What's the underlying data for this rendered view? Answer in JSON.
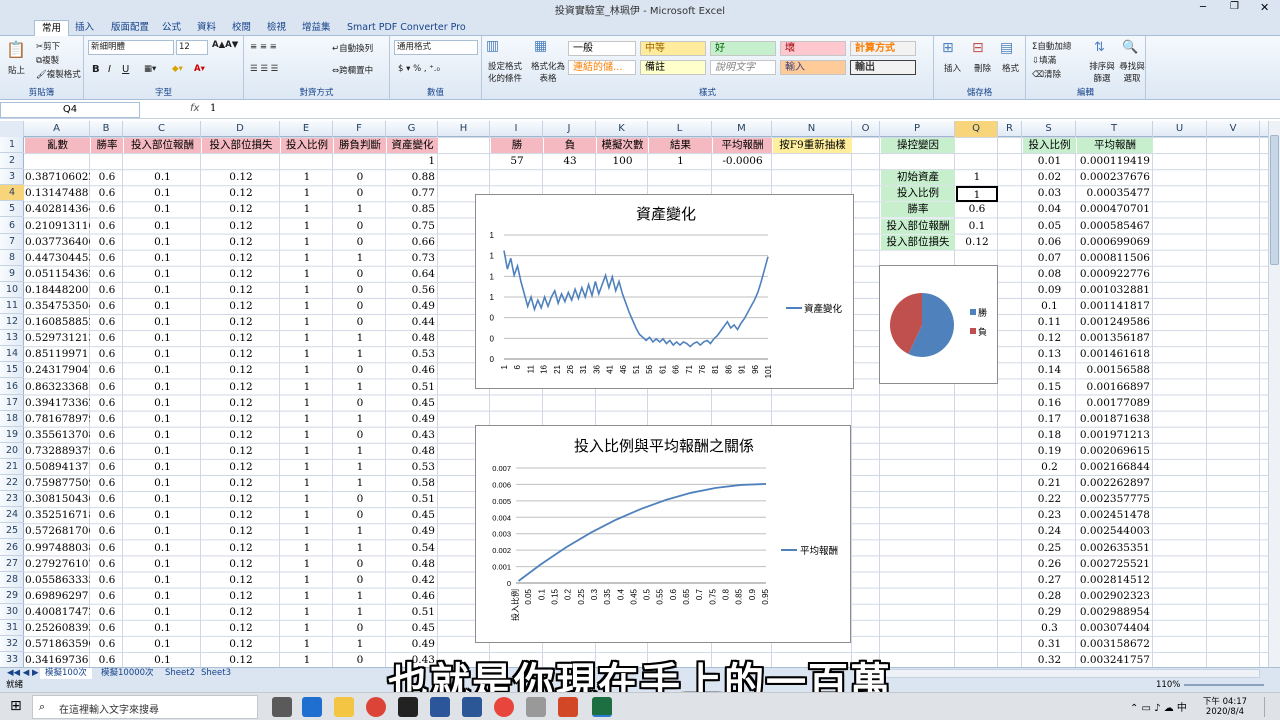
{
  "window": {
    "title": "投資實驗室_林珮伊 - Microsoft Excel"
  },
  "tabs": [
    "常用",
    "插入",
    "版面配置",
    "公式",
    "資料",
    "校閱",
    "檢視",
    "增益集",
    "Smart PDF Converter Pro"
  ],
  "ribbon": {
    "paste": "貼上",
    "cut": "剪下",
    "copy": "複製",
    "format_painter": "複製格式",
    "font_name": "新細明體",
    "font_size": "12",
    "num_format": "通用格式",
    "wrap": "自動換列",
    "merge": "跨欄置中",
    "cond_format": "設定格式化的條件",
    "table_format": "格式化為表格",
    "styles": [
      "一般",
      "中等",
      "好",
      "壞",
      "計算方式",
      "連結的儲...",
      "備註",
      "說明文字",
      "輸入",
      "輸出"
    ],
    "insert": "插入",
    "delete": "刪除",
    "format": "格式",
    "autosum": "自動加總",
    "fill": "填滿",
    "clear": "清除",
    "sort": "排序與篩選",
    "find": "尋找與選取",
    "groups": [
      "剪貼簿",
      "字型",
      "對齊方式",
      "數值",
      "樣式",
      "儲存格",
      "編輯"
    ]
  },
  "formula_bar": {
    "name_box": "Q4",
    "fx": "fx",
    "value": "1"
  },
  "columns": [
    "A",
    "B",
    "C",
    "D",
    "E",
    "F",
    "G",
    "H",
    "I",
    "J",
    "K",
    "L",
    "M",
    "N",
    "O",
    "P",
    "Q",
    "R",
    "S",
    "T",
    "U",
    "V"
  ],
  "rows": [
    "1",
    "2",
    "3",
    "4",
    "5",
    "6",
    "7",
    "8",
    "9",
    "10",
    "11",
    "12",
    "13",
    "14",
    "15",
    "16",
    "17",
    "18",
    "19",
    "20",
    "21",
    "22",
    "23",
    "24",
    "25",
    "26",
    "27",
    "28",
    "29",
    "30",
    "31",
    "32",
    "33"
  ],
  "headers_left": [
    "亂數",
    "勝率",
    "投入部位報酬",
    "投入部位損失",
    "投入比例",
    "勝負判斷",
    "資產變化"
  ],
  "g2": "1",
  "left_data": [
    [
      "0.387106022",
      "0.6",
      "0.1",
      "0.12",
      "1",
      "0",
      "0.88"
    ],
    [
      "0.131474881",
      "0.6",
      "0.1",
      "0.12",
      "1",
      "0",
      "0.77"
    ],
    [
      "0.402814364",
      "0.6",
      "0.1",
      "0.12",
      "1",
      "1",
      "0.85"
    ],
    [
      "0.210913116",
      "0.6",
      "0.1",
      "0.12",
      "1",
      "0",
      "0.75"
    ],
    [
      "0.037736406",
      "0.6",
      "0.1",
      "0.12",
      "1",
      "0",
      "0.66"
    ],
    [
      "0.447304453",
      "0.6",
      "0.1",
      "0.12",
      "1",
      "1",
      "0.73"
    ],
    [
      "0.051154362",
      "0.6",
      "0.1",
      "0.12",
      "1",
      "0",
      "0.64"
    ],
    [
      "0.184482001",
      "0.6",
      "0.1",
      "0.12",
      "1",
      "0",
      "0.56"
    ],
    [
      "0.354753504",
      "0.6",
      "0.1",
      "0.12",
      "1",
      "0",
      "0.49"
    ],
    [
      "0.160858852",
      "0.6",
      "0.1",
      "0.12",
      "1",
      "0",
      "0.44"
    ],
    [
      "0.529731213",
      "0.6",
      "0.1",
      "0.12",
      "1",
      "1",
      "0.48"
    ],
    [
      "0.85119971",
      "0.6",
      "0.1",
      "0.12",
      "1",
      "1",
      "0.53"
    ],
    [
      "0.243179047",
      "0.6",
      "0.1",
      "0.12",
      "1",
      "0",
      "0.46"
    ],
    [
      "0.86323368",
      "0.6",
      "0.1",
      "0.12",
      "1",
      "1",
      "0.51"
    ],
    [
      "0.394173362",
      "0.6",
      "0.1",
      "0.12",
      "1",
      "0",
      "0.45"
    ],
    [
      "0.781678979",
      "0.6",
      "0.1",
      "0.12",
      "1",
      "1",
      "0.49"
    ],
    [
      "0.355613708",
      "0.6",
      "0.1",
      "0.12",
      "1",
      "0",
      "0.43"
    ],
    [
      "0.732889379",
      "0.6",
      "0.1",
      "0.12",
      "1",
      "1",
      "0.48"
    ],
    [
      "0.508941371",
      "0.6",
      "0.1",
      "0.12",
      "1",
      "1",
      "0.53"
    ],
    [
      "0.759877509",
      "0.6",
      "0.1",
      "0.12",
      "1",
      "1",
      "0.58"
    ],
    [
      "0.308150436",
      "0.6",
      "0.1",
      "0.12",
      "1",
      "0",
      "0.51"
    ],
    [
      "0.352516718",
      "0.6",
      "0.1",
      "0.12",
      "1",
      "0",
      "0.45"
    ],
    [
      "0.572681706",
      "0.6",
      "0.1",
      "0.12",
      "1",
      "1",
      "0.49"
    ],
    [
      "0.997488038",
      "0.6",
      "0.1",
      "0.12",
      "1",
      "1",
      "0.54"
    ],
    [
      "0.279276107",
      "0.6",
      "0.1",
      "0.12",
      "1",
      "0",
      "0.48"
    ],
    [
      "0.055863335",
      "0.6",
      "0.1",
      "0.12",
      "1",
      "0",
      "0.42"
    ],
    [
      "0.69896297",
      "0.6",
      "0.1",
      "0.12",
      "1",
      "1",
      "0.46"
    ],
    [
      "0.400817472",
      "0.6",
      "0.1",
      "0.12",
      "1",
      "1",
      "0.51"
    ],
    [
      "0.252608393",
      "0.6",
      "0.1",
      "0.12",
      "1",
      "0",
      "0.45"
    ],
    [
      "0.571863596",
      "0.6",
      "0.1",
      "0.12",
      "1",
      "1",
      "0.49"
    ],
    [
      "0.34169736",
      "0.6",
      "0.1",
      "0.12",
      "1",
      "0",
      "0.43"
    ]
  ],
  "summary": {
    "headers": [
      "勝",
      "負",
      "模擬次數",
      "結果",
      "平均報酬",
      "按F9重新抽樣"
    ],
    "values": [
      "57",
      "43",
      "100",
      "1",
      "-0.0006"
    ]
  },
  "control": {
    "title": "操控變因",
    "labels": [
      "初始資產",
      "投入比例",
      "勝率",
      "投入部位報酬",
      "投入部位損失"
    ],
    "values": [
      "1",
      "1",
      "0.6",
      "0.1",
      "0.12"
    ]
  },
  "ratio_table": {
    "headers": [
      "投入比例",
      "平均報酬"
    ],
    "ratio": [
      "0.01",
      "0.02",
      "0.03",
      "0.04",
      "0.05",
      "0.06",
      "0.07",
      "0.08",
      "0.09",
      "0.1",
      "0.11",
      "0.12",
      "0.13",
      "0.14",
      "0.15",
      "0.16",
      "0.17",
      "0.18",
      "0.19",
      "0.2",
      "0.21",
      "0.22",
      "0.23",
      "0.24",
      "0.25",
      "0.26",
      "0.27",
      "0.28",
      "0.29",
      "0.3",
      "0.31",
      "0.32"
    ],
    "avg": [
      "0.000119419",
      "0.000237676",
      "0.00035477",
      "0.000470701",
      "0.000585467",
      "0.000699069",
      "0.000811506",
      "0.000922776",
      "0.001032881",
      "0.001141817",
      "0.001249586",
      "0.001356187",
      "0.001461618",
      "0.00156588",
      "0.00166897",
      "0.00177089",
      "0.001871638",
      "0.001971213",
      "0.002069615",
      "0.002166844",
      "0.002262897",
      "0.002357775",
      "0.002451478",
      "0.002544003",
      "0.002635351",
      "0.002725521",
      "0.002814512",
      "0.002902323",
      "0.002988954",
      "0.003074404",
      "0.003158672",
      "0.003241757"
    ]
  },
  "chart_data": [
    {
      "type": "line",
      "title": "資產變化",
      "legend": [
        "資產變化"
      ],
      "legend_position": "right",
      "yticks": [
        "0",
        "0",
        "0",
        "1",
        "1",
        "1",
        "1"
      ],
      "xticks": [
        "1",
        "6",
        "11",
        "16",
        "21",
        "26",
        "31",
        "36",
        "41",
        "46",
        "51",
        "56",
        "61",
        "66",
        "71",
        "76",
        "81",
        "86",
        "91",
        "96",
        "101"
      ],
      "values": [
        1.0,
        0.88,
        0.95,
        0.84,
        0.9,
        0.8,
        0.72,
        0.64,
        0.7,
        0.62,
        0.68,
        0.63,
        0.7,
        0.64,
        0.7,
        0.74,
        0.66,
        0.72,
        0.67,
        0.73,
        0.68,
        0.75,
        0.69,
        0.76,
        0.7,
        0.78,
        0.71,
        0.8,
        0.72,
        0.78,
        0.84,
        0.76,
        0.83,
        0.74,
        0.8,
        0.72,
        0.66,
        0.6,
        0.55,
        0.5,
        0.46,
        0.44,
        0.42,
        0.44,
        0.41,
        0.43,
        0.41,
        0.43,
        0.4,
        0.42,
        0.39,
        0.41,
        0.39,
        0.41,
        0.4,
        0.38,
        0.4,
        0.41,
        0.39,
        0.41,
        0.42,
        0.4,
        0.43,
        0.45,
        0.48,
        0.51,
        0.54,
        0.5,
        0.52,
        0.49,
        0.53,
        0.56,
        0.6,
        0.64,
        0.68,
        0.73,
        0.8,
        0.88,
        0.96
      ],
      "ylim": [
        0.3,
        1.1
      ]
    },
    {
      "type": "line",
      "title": "投入比例與平均報酬之關係",
      "legend": [
        "平均報酬"
      ],
      "legend_position": "right",
      "xlabel": "投入比例",
      "yticks": [
        "0",
        "0.001",
        "0.002",
        "0.003",
        "0.004",
        "0.005",
        "0.006",
        "0.007"
      ],
      "xticks": [
        "0.05",
        "0.1",
        "0.15",
        "0.2",
        "0.25",
        "0.3",
        "0.35",
        "0.4",
        "0.45",
        "0.5",
        "0.55",
        "0.6",
        "0.65",
        "0.7",
        "0.75",
        "0.8",
        "0.85",
        "0.9",
        "0.95"
      ],
      "x": [
        0.01,
        0.1,
        0.2,
        0.3,
        0.4,
        0.5,
        0.6,
        0.7,
        0.8,
        0.9,
        1.0
      ],
      "values": [
        0.00012,
        0.00114,
        0.00217,
        0.00307,
        0.00385,
        0.00451,
        0.00506,
        0.00549,
        0.00579,
        0.00597,
        0.00603
      ],
      "ylim": [
        0,
        0.007
      ]
    },
    {
      "type": "pie",
      "legend": [
        "勝",
        "負"
      ],
      "values": [
        57,
        43
      ],
      "colors": [
        "#4f81bd",
        "#c0504d"
      ],
      "legend_position": "right"
    }
  ],
  "sheets": [
    "模擬100次",
    "模擬10000次",
    "Sheet2",
    "Sheet3"
  ],
  "status": {
    "mode": "就緒",
    "zoom": "110%"
  },
  "taskbar": {
    "search": "在這裡輸入文字來搜尋",
    "time": "下午 04:17",
    "date": "2020/8/4"
  },
  "subtitle": "也就是你現在手上的一百萬"
}
